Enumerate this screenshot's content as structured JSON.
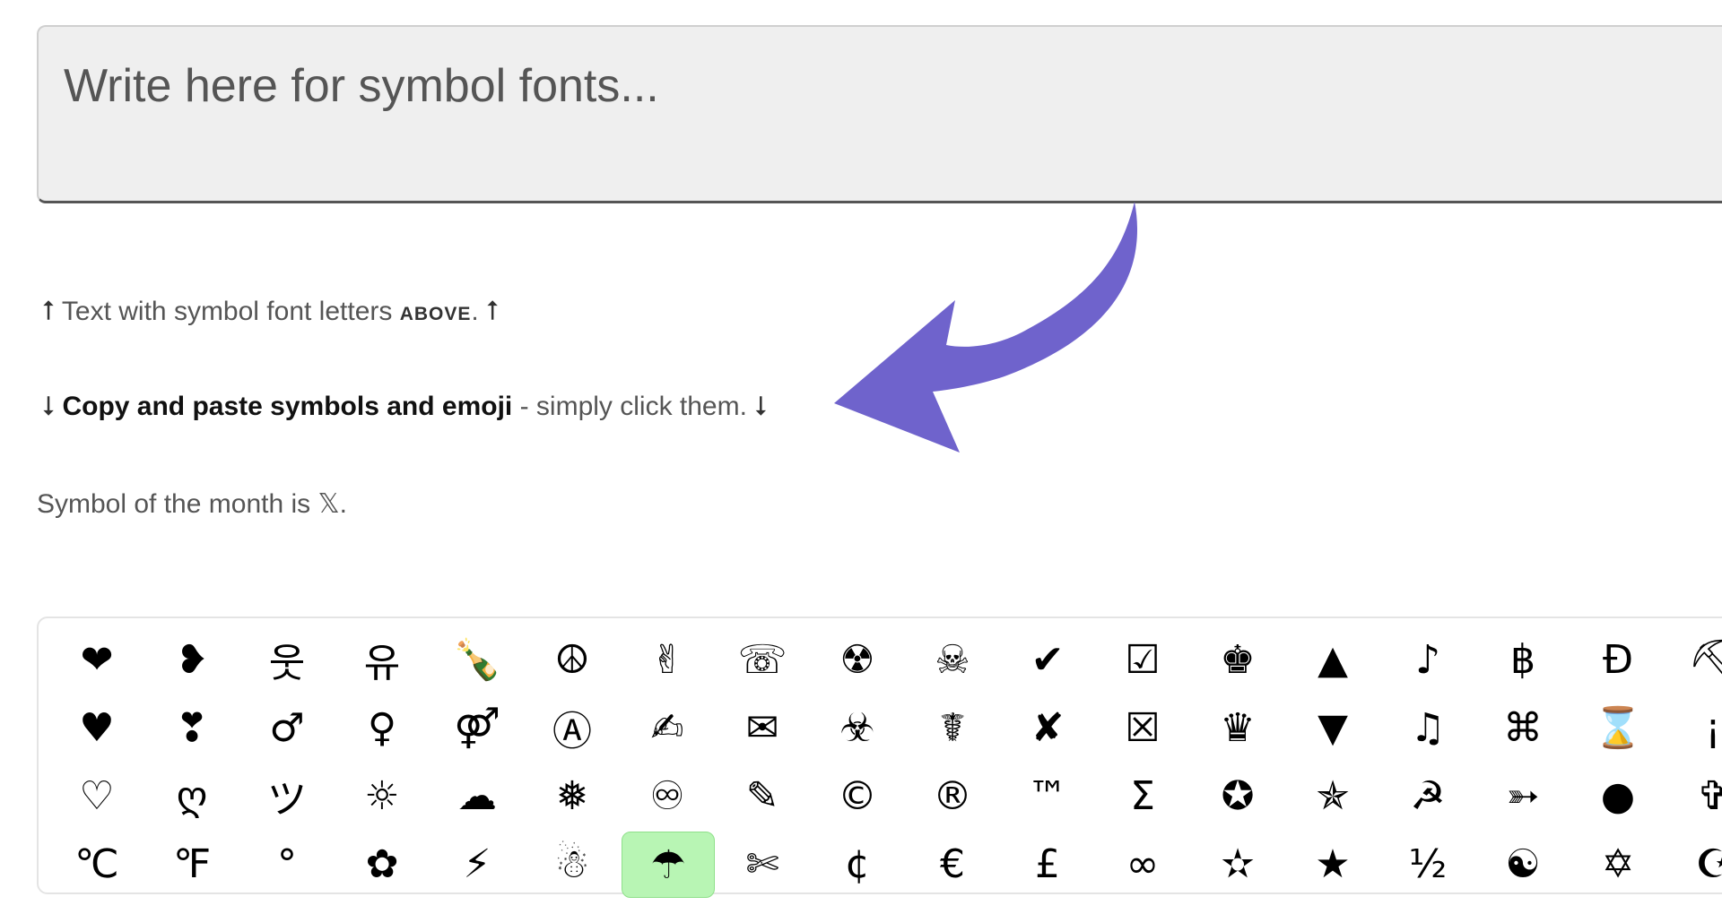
{
  "input": {
    "placeholder": "Write here for symbol fonts...",
    "value": ""
  },
  "hint_above": {
    "arrow": "⭡",
    "text": "Text with symbol font letters ",
    "caps": "above",
    "suffix": ".",
    "arrow_end": "⭡"
  },
  "hint_below": {
    "arrow": "⭣",
    "bold": "Copy and paste symbols and emoji",
    "rest": " - simply click them.",
    "arrow_end": "⭣"
  },
  "symbol_month": {
    "text": "Symbol of the month is 𝕏."
  },
  "colors": {
    "arrow": "#6f63cc",
    "selected_bg": "#b8f5b4"
  },
  "symbols": [
    [
      "❤",
      "❥",
      "웃",
      "유",
      "🍾",
      "☮",
      "✌",
      "☏",
      "☢",
      "☠",
      "✔",
      "☑",
      "♚",
      "▲",
      "♪",
      "฿",
      "Ɖ",
      "⛏"
    ],
    [
      "♥",
      "❣",
      "♂",
      "♀",
      "⚤",
      "Ⓐ",
      "✍",
      "✉",
      "☣",
      "☤",
      "✘",
      "☒",
      "♛",
      "▼",
      "♫",
      "⌘",
      "⌛",
      "¡"
    ],
    [
      "♡",
      "ღ",
      "ツ",
      "☼",
      "☁",
      "❅",
      "♾",
      "✎",
      "©",
      "®",
      "™",
      "Σ",
      "✪",
      "✯",
      "☭",
      "➳",
      "●",
      "✞"
    ],
    [
      "℃",
      "℉",
      "°",
      "✿",
      "⚡",
      "☃",
      "☂",
      "✄",
      "¢",
      "€",
      "£",
      "∞",
      "✫",
      "★",
      "½",
      "☯",
      "✡",
      "☪"
    ]
  ],
  "selected_symbol": "☂"
}
